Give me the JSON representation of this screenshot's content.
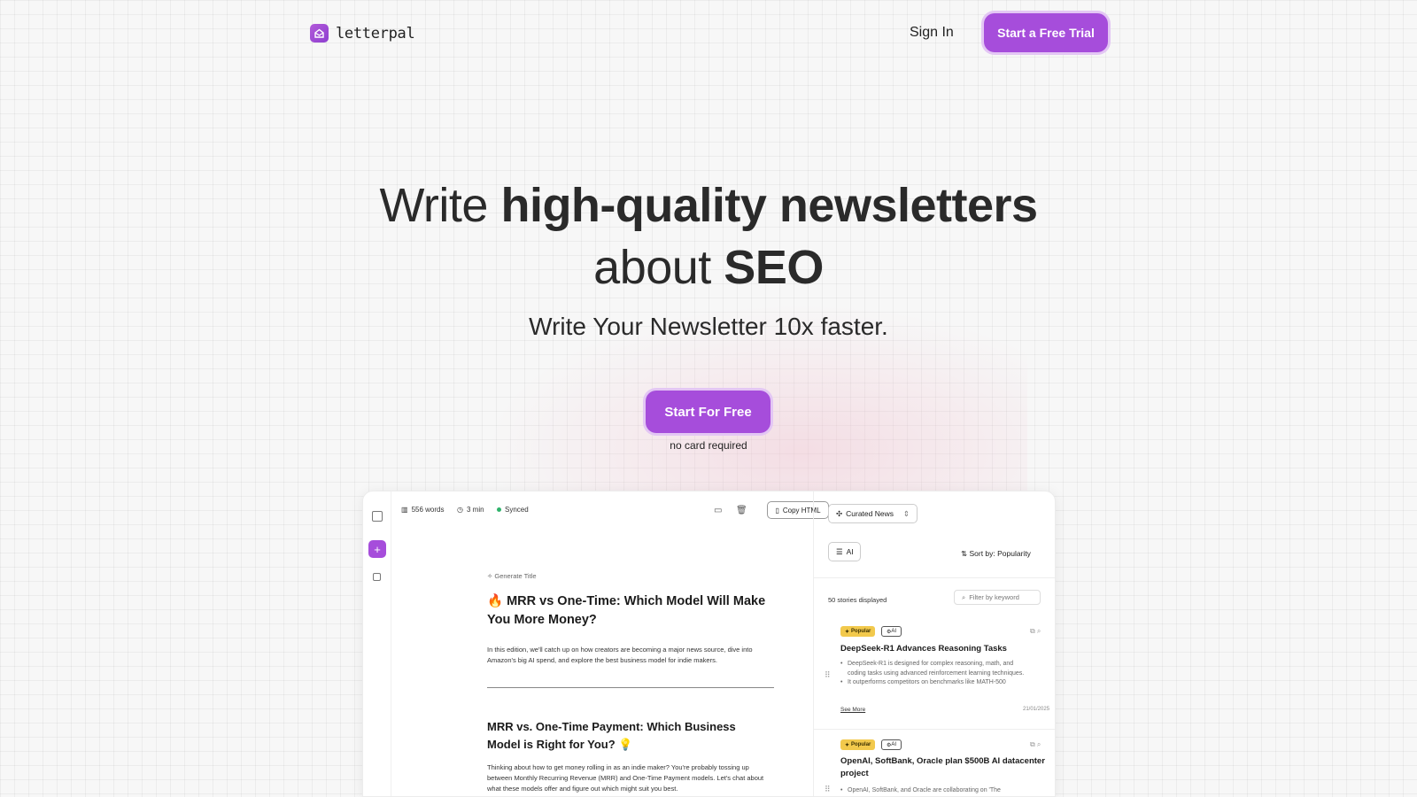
{
  "brand": {
    "name": "letterpal",
    "accent": "#a64ddb"
  },
  "nav": {
    "signin": "Sign In",
    "trial": "Start a Free Trial"
  },
  "hero": {
    "w1": "Write ",
    "b1": "high-quality newsletters",
    "w2": "about ",
    "b2": "SEO",
    "sub": "Write Your Newsletter 10x faster.",
    "cta": "Start For Free",
    "note": "no card required"
  },
  "editor": {
    "words": "556 words",
    "time": "3 min",
    "sync": "Synced",
    "copy": "Copy HTML",
    "generate": "Generate Title",
    "title": "🔥 MRR vs One-Time: Which Model Will Make You More Money?",
    "intro": "In this edition, we'll catch up on how creators are becoming a major news source, dive into Amazon's big AI spend, and explore the best business model for indie makers.",
    "section_title": "MRR vs. One-Time Payment: Which Business Model is Right for You? 💡",
    "section_body": "Thinking about how to get money rolling in as an indie maker? You're probably tossing up between Monthly Recurring Revenue (MRR) and One-Time Payment models. Let's chat about what these models offer and figure out which might suit you best."
  },
  "panel": {
    "source": "Curated News",
    "topic": "AI",
    "sort": "Sort by: Popularity",
    "count": "50 stories displayed",
    "filter_placeholder": "Filter by keyword",
    "stories": [
      {
        "badge": "Popular",
        "tag": "AI",
        "title": "DeepSeek-R1 Advances Reasoning Tasks",
        "b1": "DeepSeek-R1 is designed for complex reasoning, math, and coding tasks using advanced reinforcement learning techniques.",
        "b2": "It outperforms competitors on benchmarks like MATH-500",
        "more": "See More",
        "date": "21/01/2025"
      },
      {
        "badge": "Popular",
        "tag": "AI",
        "title": "OpenAI, SoftBank, Oracle plan $500B AI datacenter project",
        "b1": "OpenAI, SoftBank, and Oracle are collaborating on 'The"
      }
    ]
  }
}
